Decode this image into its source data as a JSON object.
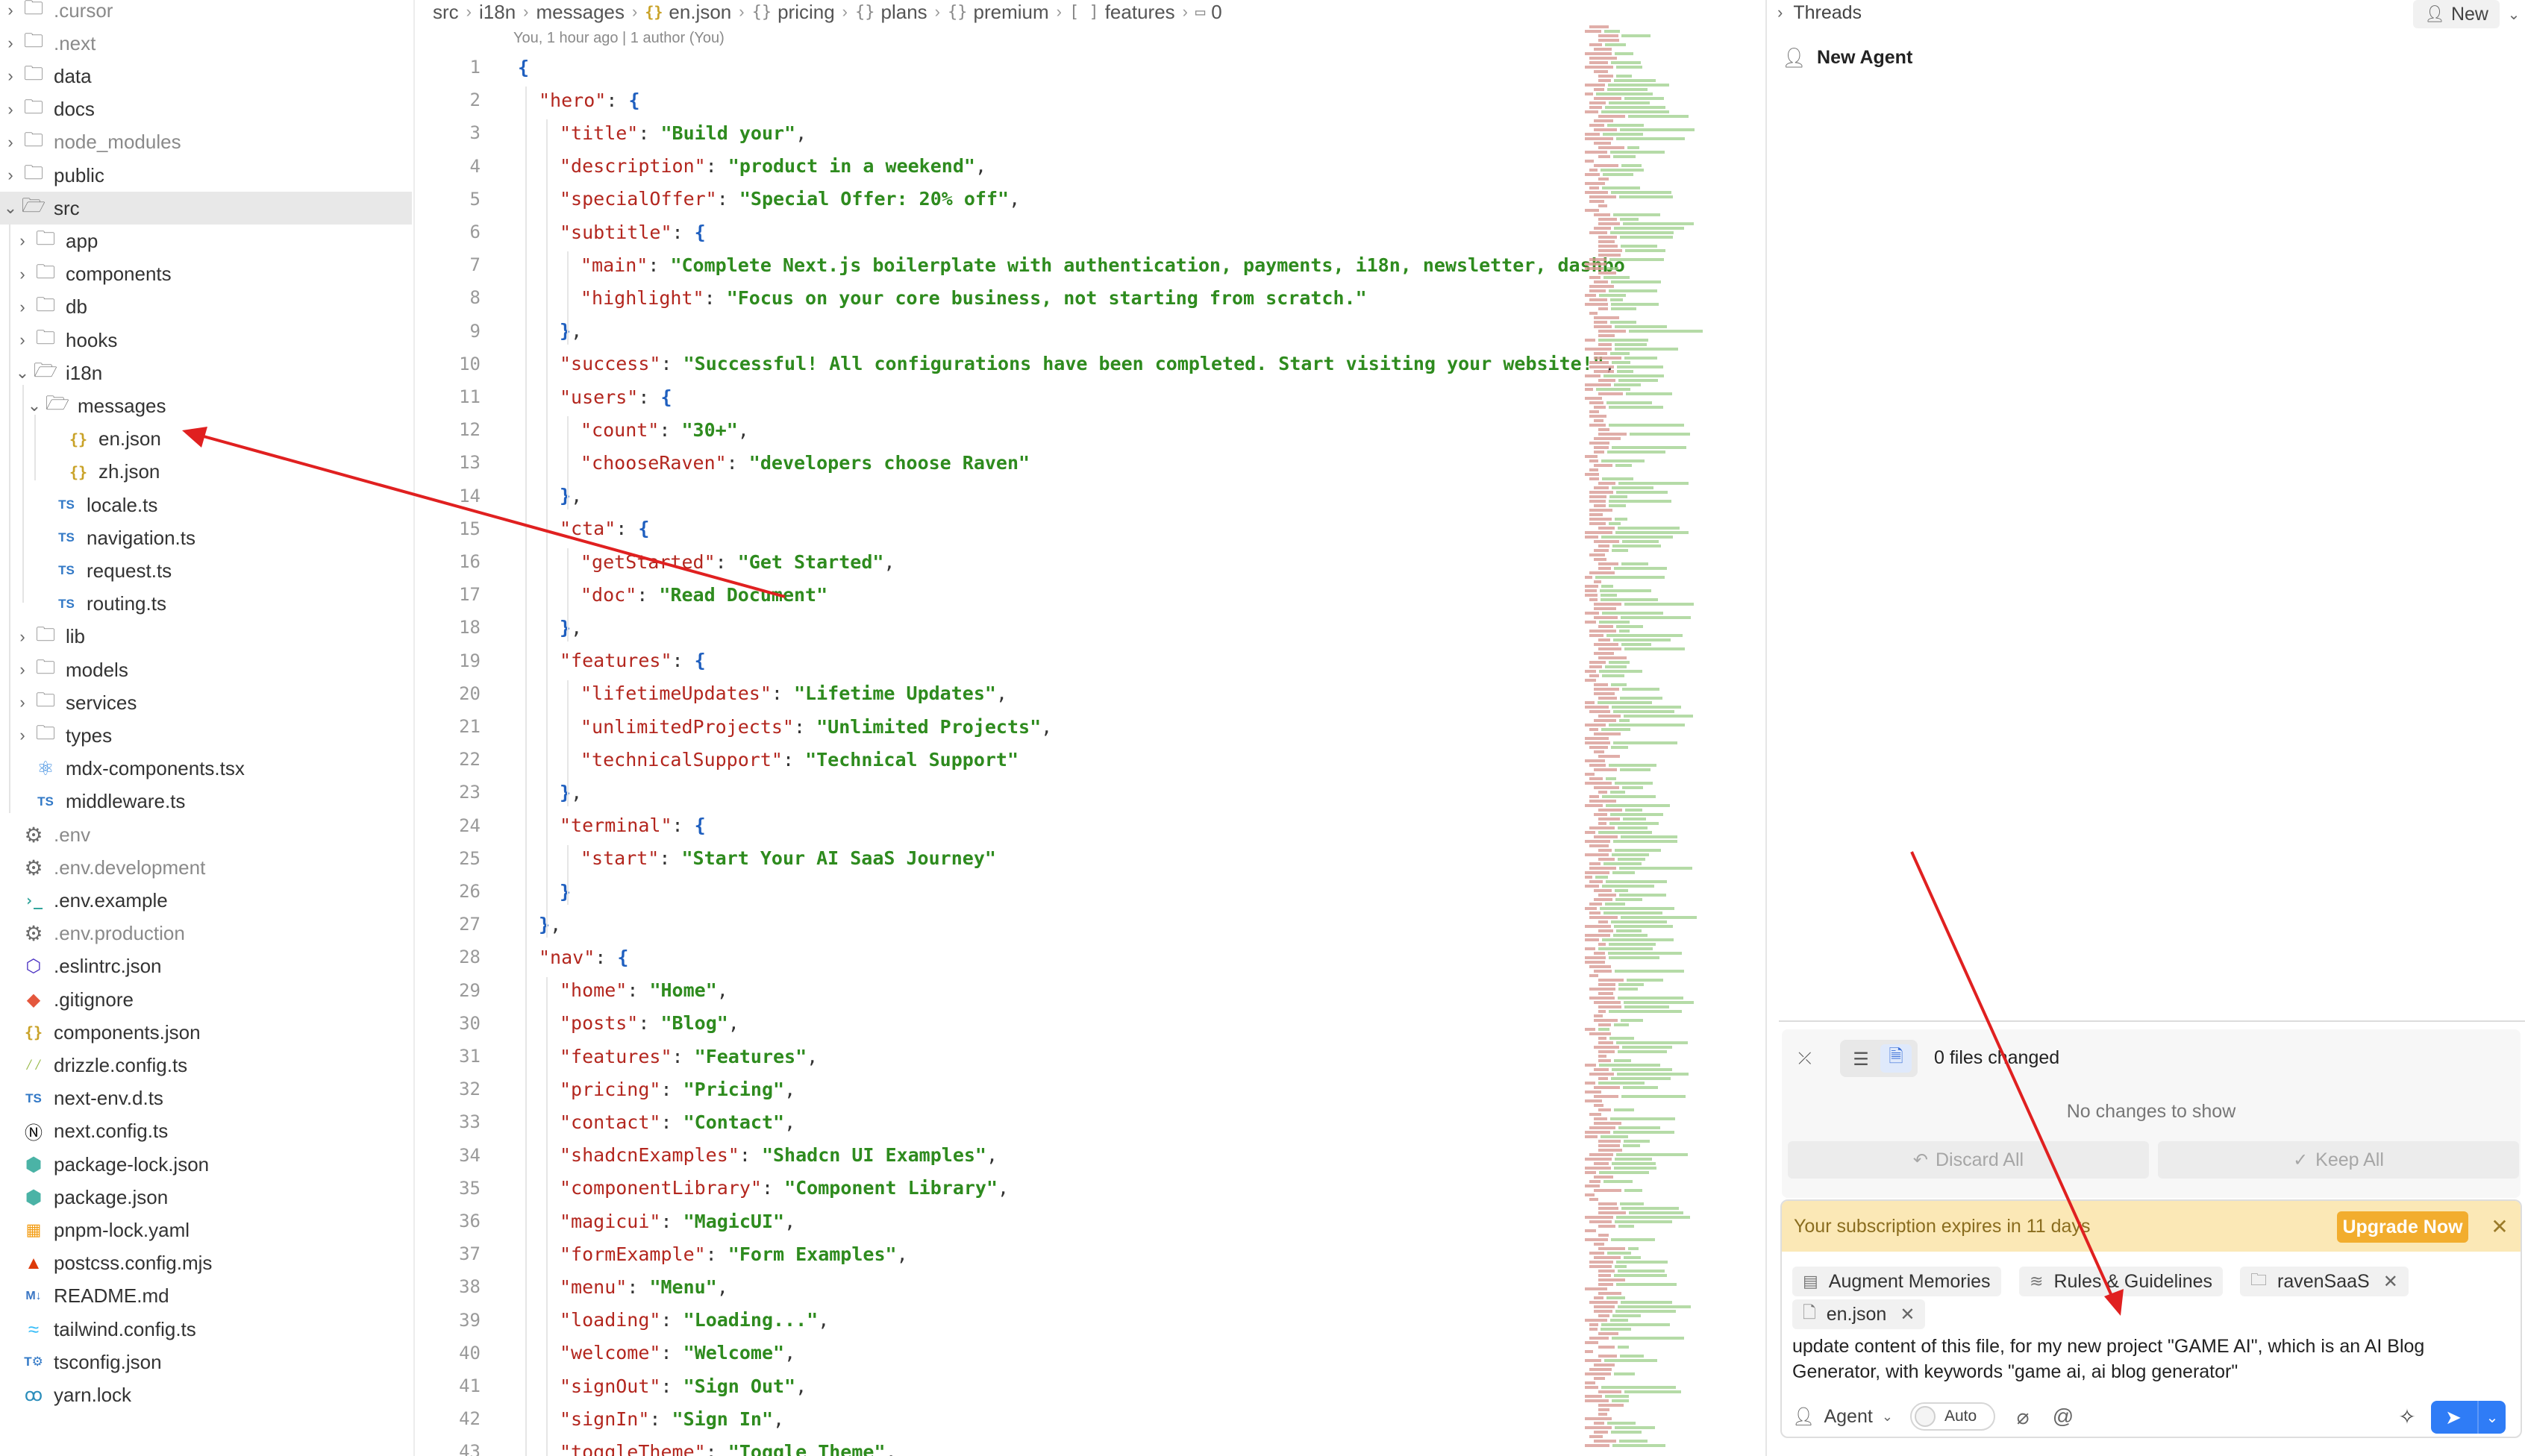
{
  "explorer": {
    "items": [
      {
        "label": ".cursor",
        "icon": "folder-icon",
        "kind": "folder",
        "depth": 0,
        "dim": true
      },
      {
        "label": ".next",
        "icon": "folder-icon",
        "kind": "folder",
        "depth": 0,
        "dim": true
      },
      {
        "label": "data",
        "icon": "folder-icon",
        "kind": "folder",
        "depth": 0,
        "dim": false
      },
      {
        "label": "docs",
        "icon": "folder-icon",
        "kind": "folder",
        "depth": 0,
        "dim": false
      },
      {
        "label": "node_modules",
        "icon": "folder-icon",
        "kind": "folder",
        "depth": 0,
        "dim": true
      },
      {
        "label": "public",
        "icon": "folder-icon",
        "kind": "folder",
        "depth": 0,
        "dim": false
      },
      {
        "label": "src",
        "icon": "folder-open-icon",
        "kind": "folder-open",
        "depth": 0,
        "dim": false,
        "selected": true
      },
      {
        "label": "app",
        "icon": "folder-icon",
        "kind": "folder",
        "depth": 1,
        "dim": false
      },
      {
        "label": "components",
        "icon": "folder-icon",
        "kind": "folder",
        "depth": 1,
        "dim": false
      },
      {
        "label": "db",
        "icon": "folder-icon",
        "kind": "folder",
        "depth": 1,
        "dim": false
      },
      {
        "label": "hooks",
        "icon": "folder-icon",
        "kind": "folder",
        "depth": 1,
        "dim": false
      },
      {
        "label": "i18n",
        "icon": "folder-open-icon",
        "kind": "folder-open",
        "depth": 1,
        "dim": false
      },
      {
        "label": "messages",
        "icon": "folder-open-icon",
        "kind": "folder-open",
        "depth": 2,
        "dim": false
      },
      {
        "label": "en.json",
        "icon": "json-file-icon",
        "kind": "json",
        "depth": 3,
        "dim": false
      },
      {
        "label": "zh.json",
        "icon": "json-file-icon",
        "kind": "json",
        "depth": 3,
        "dim": false
      },
      {
        "label": "locale.ts",
        "icon": "typescript-file-icon",
        "kind": "ts",
        "depth": 2,
        "dim": false
      },
      {
        "label": "navigation.ts",
        "icon": "typescript-file-icon",
        "kind": "ts",
        "depth": 2,
        "dim": false
      },
      {
        "label": "request.ts",
        "icon": "typescript-file-icon",
        "kind": "ts",
        "depth": 2,
        "dim": false
      },
      {
        "label": "routing.ts",
        "icon": "typescript-file-icon",
        "kind": "ts",
        "depth": 2,
        "dim": false
      },
      {
        "label": "lib",
        "icon": "folder-icon",
        "kind": "folder",
        "depth": 1,
        "dim": false
      },
      {
        "label": "models",
        "icon": "folder-icon",
        "kind": "folder",
        "depth": 1,
        "dim": false
      },
      {
        "label": "services",
        "icon": "folder-icon",
        "kind": "folder",
        "depth": 1,
        "dim": false
      },
      {
        "label": "types",
        "icon": "folder-icon",
        "kind": "folder",
        "depth": 1,
        "dim": false
      },
      {
        "label": "mdx-components.tsx",
        "icon": "react-file-icon",
        "kind": "react",
        "depth": 1,
        "dim": false
      },
      {
        "label": "middleware.ts",
        "icon": "typescript-file-icon",
        "kind": "ts",
        "depth": 1,
        "dim": false
      },
      {
        "label": ".env",
        "icon": "gear-file-icon",
        "kind": "gear",
        "depth": 0,
        "dim": true
      },
      {
        "label": ".env.development",
        "icon": "gear-file-icon",
        "kind": "gear",
        "depth": 0,
        "dim": true
      },
      {
        "label": ".env.example",
        "icon": "terminal-file-icon",
        "kind": "term",
        "depth": 0,
        "dim": false
      },
      {
        "label": ".env.production",
        "icon": "gear-file-icon",
        "kind": "gear",
        "depth": 0,
        "dim": true
      },
      {
        "label": ".eslintrc.json",
        "icon": "eslint-file-icon",
        "kind": "eslint",
        "depth": 0,
        "dim": false
      },
      {
        "label": ".gitignore",
        "icon": "git-file-icon",
        "kind": "git",
        "depth": 0,
        "dim": false
      },
      {
        "label": "components.json",
        "icon": "json-file-icon",
        "kind": "json",
        "depth": 0,
        "dim": false
      },
      {
        "label": "drizzle.config.ts",
        "icon": "drizzle-file-icon",
        "kind": "drizzle",
        "depth": 0,
        "dim": false
      },
      {
        "label": "next-env.d.ts",
        "icon": "typescript-file-icon",
        "kind": "ts",
        "depth": 0,
        "dim": false
      },
      {
        "label": "next.config.ts",
        "icon": "next-file-icon",
        "kind": "next",
        "depth": 0,
        "dim": false
      },
      {
        "label": "package-lock.json",
        "icon": "npm-file-icon",
        "kind": "npm",
        "depth": 0,
        "dim": false
      },
      {
        "label": "package.json",
        "icon": "npm-file-icon",
        "kind": "npm",
        "depth": 0,
        "dim": false
      },
      {
        "label": "pnpm-lock.yaml",
        "icon": "pnpm-file-icon",
        "kind": "pnpm",
        "depth": 0,
        "dim": false
      },
      {
        "label": "postcss.config.mjs",
        "icon": "postcss-file-icon",
        "kind": "postcss",
        "depth": 0,
        "dim": false
      },
      {
        "label": "README.md",
        "icon": "markdown-file-icon",
        "kind": "md",
        "depth": 0,
        "dim": false
      },
      {
        "label": "tailwind.config.ts",
        "icon": "tailwind-file-icon",
        "kind": "tw",
        "depth": 0,
        "dim": false
      },
      {
        "label": "tsconfig.json",
        "icon": "tsconfig-file-icon",
        "kind": "tsconf",
        "depth": 0,
        "dim": false
      },
      {
        "label": "yarn.lock",
        "icon": "yarn-file-icon",
        "kind": "yarn",
        "depth": 0,
        "dim": false
      }
    ]
  },
  "editor": {
    "breadcrumb": [
      "src",
      "i18n",
      "messages",
      "en.json",
      "pricing",
      "plans",
      "premium",
      "features",
      "0"
    ],
    "blame": "You, 1 hour ago | 1 author (You)",
    "lines": [
      {
        "n": "1",
        "indent": 0,
        "text": "{"
      },
      {
        "n": "2",
        "indent": 1,
        "text": "\"hero\": {"
      },
      {
        "n": "3",
        "indent": 2,
        "text": "\"title\": \"Build your\","
      },
      {
        "n": "4",
        "indent": 2,
        "text": "\"description\": \"product in a weekend\","
      },
      {
        "n": "5",
        "indent": 2,
        "text": "\"specialOffer\": \"Special Offer: 20% off\","
      },
      {
        "n": "6",
        "indent": 2,
        "text": "\"subtitle\": {"
      },
      {
        "n": "7",
        "indent": 3,
        "text": "\"main\": \"Complete Next.js boilerplate with authentication, payments, i18n, newsletter, dashbo"
      },
      {
        "n": "8",
        "indent": 3,
        "text": "\"highlight\": \"Focus on your core business, not starting from scratch.\""
      },
      {
        "n": "9",
        "indent": 2,
        "text": "},"
      },
      {
        "n": "10",
        "indent": 2,
        "text": "\"success\": \"Successful! All configurations have been completed. Start visiting your website!\","
      },
      {
        "n": "11",
        "indent": 2,
        "text": "\"users\": {"
      },
      {
        "n": "12",
        "indent": 3,
        "text": "\"count\": \"30+\","
      },
      {
        "n": "13",
        "indent": 3,
        "text": "\"chooseRaven\": \"developers choose Raven\""
      },
      {
        "n": "14",
        "indent": 2,
        "text": "},"
      },
      {
        "n": "15",
        "indent": 2,
        "text": "\"cta\": {"
      },
      {
        "n": "16",
        "indent": 3,
        "text": "\"getStarted\": \"Get Started\","
      },
      {
        "n": "17",
        "indent": 3,
        "text": "\"doc\": \"Read Document\""
      },
      {
        "n": "18",
        "indent": 2,
        "text": "},"
      },
      {
        "n": "19",
        "indent": 2,
        "text": "\"features\": {"
      },
      {
        "n": "20",
        "indent": 3,
        "text": "\"lifetimeUpdates\": \"Lifetime Updates\","
      },
      {
        "n": "21",
        "indent": 3,
        "text": "\"unlimitedProjects\": \"Unlimited Projects\","
      },
      {
        "n": "22",
        "indent": 3,
        "text": "\"technicalSupport\": \"Technical Support\""
      },
      {
        "n": "23",
        "indent": 2,
        "text": "},"
      },
      {
        "n": "24",
        "indent": 2,
        "text": "\"terminal\": {"
      },
      {
        "n": "25",
        "indent": 3,
        "text": "\"start\": \"Start Your AI SaaS Journey\""
      },
      {
        "n": "26",
        "indent": 2,
        "text": "}"
      },
      {
        "n": "27",
        "indent": 1,
        "text": "},"
      },
      {
        "n": "28",
        "indent": 1,
        "text": "\"nav\": {"
      },
      {
        "n": "29",
        "indent": 2,
        "text": "\"home\": \"Home\","
      },
      {
        "n": "30",
        "indent": 2,
        "text": "\"posts\": \"Blog\","
      },
      {
        "n": "31",
        "indent": 2,
        "text": "\"features\": \"Features\","
      },
      {
        "n": "32",
        "indent": 2,
        "text": "\"pricing\": \"Pricing\","
      },
      {
        "n": "33",
        "indent": 2,
        "text": "\"contact\": \"Contact\","
      },
      {
        "n": "34",
        "indent": 2,
        "text": "\"shadcnExamples\": \"Shadcn UI Examples\","
      },
      {
        "n": "35",
        "indent": 2,
        "text": "\"componentLibrary\": \"Component Library\","
      },
      {
        "n": "36",
        "indent": 2,
        "text": "\"magicui\": \"MagicUI\","
      },
      {
        "n": "37",
        "indent": 2,
        "text": "\"formExample\": \"Form Examples\","
      },
      {
        "n": "38",
        "indent": 2,
        "text": "\"menu\": \"Menu\","
      },
      {
        "n": "39",
        "indent": 2,
        "text": "\"loading\": \"Loading...\","
      },
      {
        "n": "40",
        "indent": 2,
        "text": "\"welcome\": \"Welcome\","
      },
      {
        "n": "41",
        "indent": 2,
        "text": "\"signOut\": \"Sign Out\","
      },
      {
        "n": "42",
        "indent": 2,
        "text": "\"signIn\": \"Sign In\","
      },
      {
        "n": "43",
        "indent": 2,
        "text": "\"toggleTheme\": \"Toggle Theme\","
      }
    ]
  },
  "agent": {
    "threads_label": "Threads",
    "new_label": "New",
    "new_agent_label": "New Agent",
    "changes": {
      "count_label": "0 files changed",
      "empty_label": "No changes to show",
      "discard_label": "Discard All",
      "keep_label": "Keep All"
    },
    "subscription": {
      "text": "Your subscription expires in 11 days",
      "upgrade_label": "Upgrade Now"
    },
    "chips": {
      "memories": "Augment Memories",
      "rules": "Rules & Guidelines",
      "repo": "ravenSaaS",
      "file": "en.json"
    },
    "prompt": "update content of this file, for my new project \"GAME AI\", which is an AI Blog Generator, with keywords \"game ai, ai blog generator\"",
    "mode_label": "Agent",
    "auto_label": "Auto"
  },
  "colors": {
    "accent": "#2f7cf6",
    "banner": "#fbe8b6",
    "upgrade": "#f2ad2e",
    "annotation": "#e02020"
  }
}
